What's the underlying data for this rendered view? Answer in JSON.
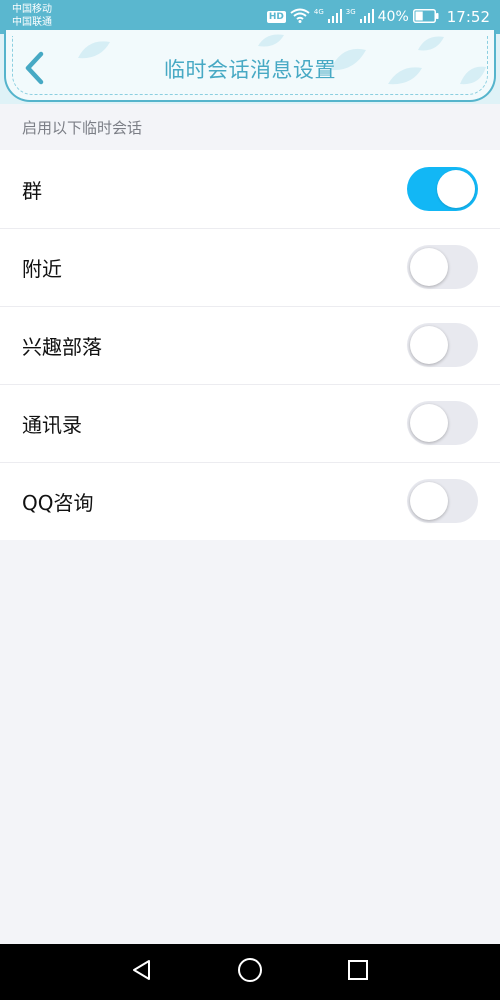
{
  "status_bar": {
    "carrier_1": "中国移动",
    "carrier_2": "中国联通",
    "hd_badge": "HD",
    "network_1": "4G",
    "network_2": "3G",
    "battery_percent": "40%",
    "battery_level": 0.4,
    "time": "17:52"
  },
  "header": {
    "title": "临时会话消息设置",
    "back_icon": "chevron-left-icon"
  },
  "section": {
    "label": "启用以下临时会话"
  },
  "settings": [
    {
      "label": "群",
      "enabled": true
    },
    {
      "label": "附近",
      "enabled": false
    },
    {
      "label": "兴趣部落",
      "enabled": false
    },
    {
      "label": "通讯录",
      "enabled": false
    },
    {
      "label": "QQ咨询",
      "enabled": false
    }
  ],
  "nav_bar": {
    "back_icon": "triangle-back-icon",
    "home_icon": "circle-home-icon",
    "recents_icon": "square-recents-icon"
  },
  "colors": {
    "status_bar": "#5ab7cf",
    "header_title": "#47a9c4",
    "toggle_on": "#12b7f5",
    "toggle_off": "#e8e9ef",
    "background": "#f3f4f8"
  }
}
